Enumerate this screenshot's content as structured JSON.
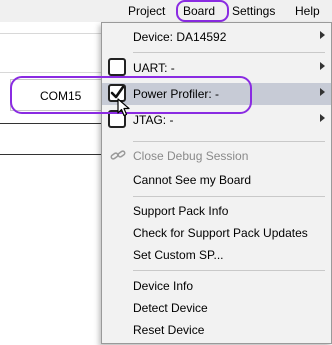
{
  "menubar": {
    "items": [
      {
        "label": "Project"
      },
      {
        "label": "Board"
      },
      {
        "label": "Settings"
      },
      {
        "label": "Help"
      }
    ]
  },
  "port_field": {
    "value": "COM15"
  },
  "board_menu": {
    "device": "Device: DA14592",
    "uart": "UART: -",
    "power_profiler": "Power Profiler: -",
    "jtag": "JTAG: -",
    "close_debug": "Close Debug Session",
    "cannot_see": "Cannot See my Board",
    "support_pack_info": "Support Pack Info",
    "check_updates": "Check for Support Pack Updates",
    "set_custom_sp": "Set Custom SP...",
    "device_info": "Device Info",
    "detect_device": "Detect Device",
    "reset_device": "Reset Device"
  },
  "colors": {
    "highlight_ring": "#8a2be2",
    "selected_row": "#c7cbd6"
  }
}
